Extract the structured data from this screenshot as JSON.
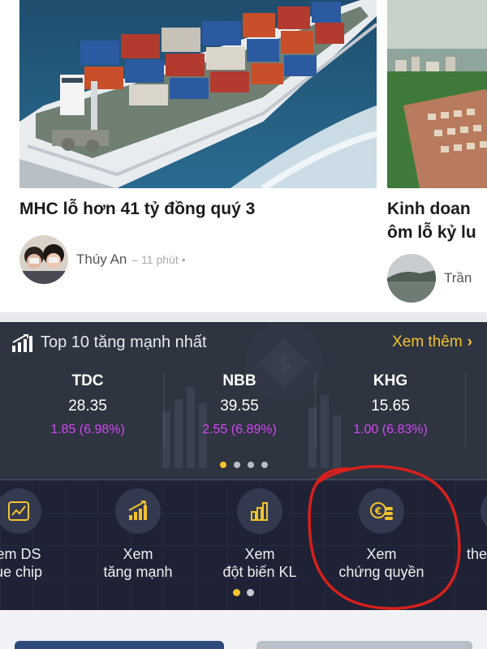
{
  "news": [
    {
      "headline": "MHC lỗ hơn 41 tỷ đồng quý 3",
      "author": "Thúy An",
      "meta": "– 11 phút •"
    },
    {
      "headline_lines": [
        "Kinh doan",
        "ôm lỗ kỷ lu"
      ],
      "author": "Trần"
    }
  ],
  "top_gainers": {
    "title": "Top 10 tăng mạnh nhất",
    "see_more": "Xem thêm",
    "stocks": [
      {
        "code": "TDC",
        "price": "28.35",
        "change": "1.85 (6.98%)"
      },
      {
        "code": "NBB",
        "price": "39.55",
        "change": "2.55 (6.89%)"
      },
      {
        "code": "KHG",
        "price": "15.65",
        "change": "1.00 (6.83%)"
      }
    ],
    "page_index": 0,
    "page_count": 4
  },
  "quick_actions": {
    "items": [
      {
        "label": "em DS\nue chip",
        "icon": "bluechip-chart-icon"
      },
      {
        "label": "Xem\ntăng mạnh",
        "icon": "rising-chart-icon"
      },
      {
        "label": "Xem\nđột biến KL",
        "icon": "volume-bars-icon"
      },
      {
        "label": "Xem\nchứng quyền",
        "icon": "euro-coins-icon"
      },
      {
        "label": "the",
        "icon": "partial-icon"
      }
    ],
    "page_index": 0,
    "page_count": 2
  },
  "colors": {
    "accent_yellow": "#f3c32d",
    "change_purple": "#d248f5",
    "panel_bg": "#2e3440",
    "actions_bg": "#1e2234",
    "annotation_red": "#d8201c"
  }
}
